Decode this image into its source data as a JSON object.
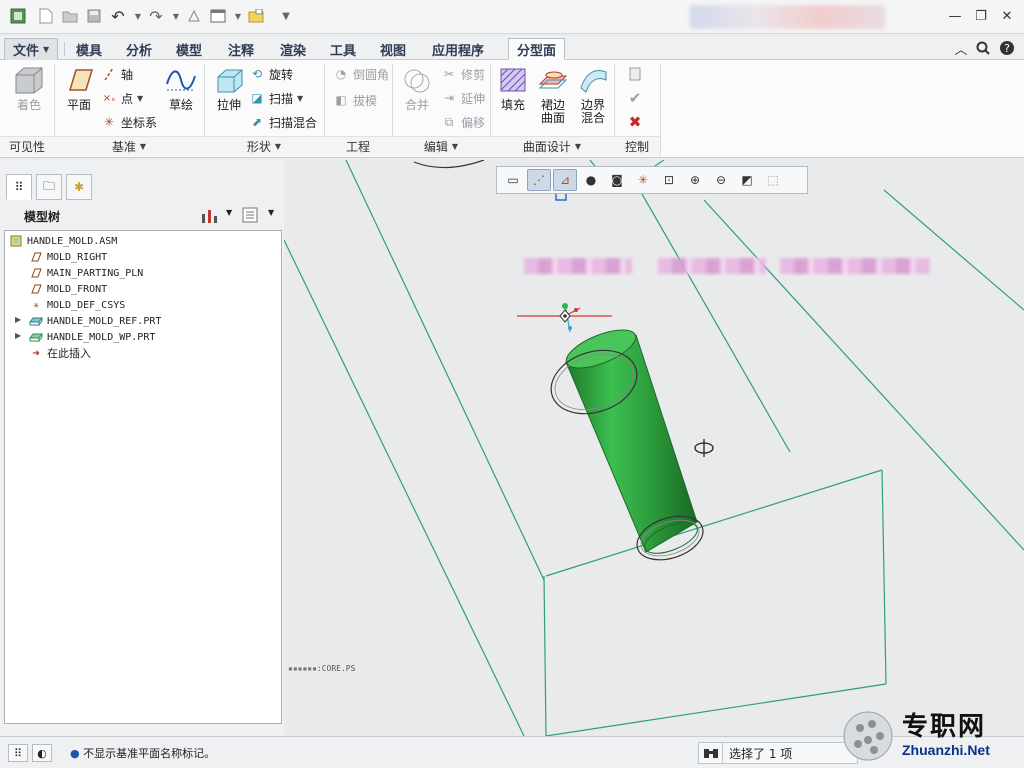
{
  "qat": {
    "icons": [
      "app-icon",
      "new-icon",
      "open-icon",
      "save-icon",
      "undo-icon",
      "redo-icon",
      "regenerate-icon",
      "windows-icon",
      "close-window-icon",
      "customize-icon"
    ],
    "window_controls": [
      "minimize",
      "restore",
      "close"
    ]
  },
  "menu": {
    "file": "文件",
    "tabs": [
      "模具",
      "分析",
      "模型",
      "注释",
      "渲染",
      "工具",
      "视图",
      "应用程序"
    ],
    "active_tab": "分型面"
  },
  "ribbon": {
    "visibility": {
      "shade": "着色",
      "footer": "可见性"
    },
    "datum": {
      "plane": "平面",
      "axis": "轴",
      "point": "点",
      "csys": "坐标系",
      "sketch": "草绘",
      "footer": "基准"
    },
    "shapes": {
      "extrude": "拉伸",
      "revolve": "旋转",
      "sweep": "扫描",
      "swept_blend": "扫描混合",
      "footer": "形状"
    },
    "engineering": {
      "round": "倒圆角",
      "draft": "拔模",
      "footer": "工程"
    },
    "editing": {
      "merge": "合并",
      "trim": "修剪",
      "extend": "延伸",
      "offset": "偏移",
      "footer": "编辑"
    },
    "surface": {
      "fill": "填充",
      "skirt1": "裙边",
      "skirt2": "曲面",
      "boundary1": "边界",
      "boundary2": "混合",
      "footer": "曲面设计"
    },
    "control": {
      "footer": "控制"
    }
  },
  "panel": {
    "title": "模型树",
    "tree": [
      {
        "label": "HANDLE_MOLD.ASM",
        "icon": "assembly-icon"
      },
      {
        "label": "MOLD_RIGHT",
        "icon": "datum-plane-icon"
      },
      {
        "label": "MAIN_PARTING_PLN",
        "icon": "datum-plane-icon"
      },
      {
        "label": "MOLD_FRONT",
        "icon": "datum-plane-icon"
      },
      {
        "label": "MOLD_DEF_CSYS",
        "icon": "csys-icon"
      },
      {
        "label": "HANDLE_MOLD_REF.PRT",
        "icon": "part-icon"
      },
      {
        "label": "HANDLE_MOLD_WP.PRT",
        "icon": "part-icon"
      },
      {
        "label": "在此插入",
        "icon": "insert-arrow-icon"
      }
    ]
  },
  "viewport": {
    "label_suffix": ":CORE.PS",
    "colors": {
      "body": "#2f9e3a",
      "edges": "#2f9e7a",
      "axis_red": "#d23a2a"
    }
  },
  "status": {
    "message": "不显示基准平面名称标记。",
    "selected": "选择了 1 项"
  },
  "watermark": {
    "cn": "专职网",
    "url": "Zhuanzhi.Net"
  }
}
